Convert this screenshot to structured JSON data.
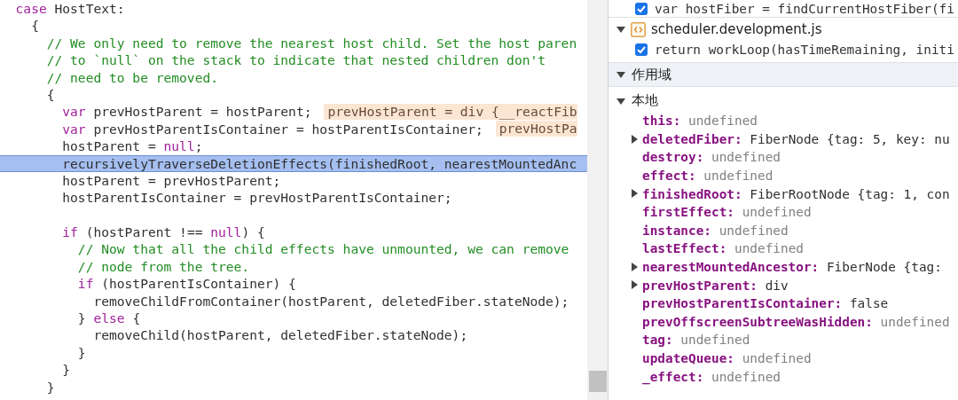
{
  "editor": {
    "lines": [
      {
        "kind": "code",
        "highlighted": false,
        "segments": [
          {
            "kind": "keyword",
            "text": "  case"
          },
          {
            "kind": "plain",
            "text": " HostText:"
          }
        ]
      },
      {
        "kind": "code",
        "highlighted": false,
        "segments": [
          {
            "kind": "plain",
            "text": "    {"
          }
        ]
      },
      {
        "kind": "code",
        "highlighted": false,
        "segments": [
          {
            "kind": "comment",
            "text": "      // We only need to remove the nearest host child. Set the host paren"
          }
        ]
      },
      {
        "kind": "code",
        "highlighted": false,
        "segments": [
          {
            "kind": "comment",
            "text": "      // to `null` on the stack to indicate that nested children don't"
          }
        ]
      },
      {
        "kind": "code",
        "highlighted": false,
        "segments": [
          {
            "kind": "comment",
            "text": "      // need to be removed."
          }
        ]
      },
      {
        "kind": "code",
        "highlighted": false,
        "segments": [
          {
            "kind": "plain",
            "text": "      {"
          }
        ]
      },
      {
        "kind": "code",
        "highlighted": false,
        "segments": [
          {
            "kind": "keyword",
            "text": "        var"
          },
          {
            "kind": "plain",
            "text": " prevHostParent = hostParent;"
          }
        ],
        "inline_value": "prevHostParent = div {__reactFib"
      },
      {
        "kind": "code",
        "highlighted": false,
        "segments": [
          {
            "kind": "keyword",
            "text": "        var"
          },
          {
            "kind": "plain",
            "text": " prevHostParentIsContainer = hostParentIsContainer;"
          }
        ],
        "inline_value": "prevHostPa"
      },
      {
        "kind": "code",
        "highlighted": false,
        "segments": [
          {
            "kind": "plain",
            "text": "        hostParent = "
          },
          {
            "kind": "keyword",
            "text": "null"
          },
          {
            "kind": "plain",
            "text": ";"
          }
        ]
      },
      {
        "kind": "code",
        "highlighted": true,
        "segments": [
          {
            "kind": "plain",
            "text": "        recursivelyTraverseDeletionEffects(finishedRoot, nearestMountedAnc"
          }
        ]
      },
      {
        "kind": "code",
        "highlighted": false,
        "segments": [
          {
            "kind": "plain",
            "text": "        hostParent = prevHostParent;"
          }
        ]
      },
      {
        "kind": "code",
        "highlighted": false,
        "segments": [
          {
            "kind": "plain",
            "text": "        hostParentIsContainer = prevHostParentIsContainer;"
          }
        ]
      },
      {
        "kind": "blank"
      },
      {
        "kind": "code",
        "highlighted": false,
        "segments": [
          {
            "kind": "keyword",
            "text": "        if"
          },
          {
            "kind": "plain",
            "text": " (hostParent !== "
          },
          {
            "kind": "keyword",
            "text": "null"
          },
          {
            "kind": "plain",
            "text": ") {"
          }
        ]
      },
      {
        "kind": "code",
        "highlighted": false,
        "segments": [
          {
            "kind": "comment",
            "text": "          // Now that all the child effects have unmounted, we can remove"
          }
        ]
      },
      {
        "kind": "code",
        "highlighted": false,
        "segments": [
          {
            "kind": "comment",
            "text": "          // node from the tree."
          }
        ]
      },
      {
        "kind": "code",
        "highlighted": false,
        "segments": [
          {
            "kind": "keyword",
            "text": "          if"
          },
          {
            "kind": "plain",
            "text": " (hostParentIsContainer) {"
          }
        ]
      },
      {
        "kind": "code",
        "highlighted": false,
        "segments": [
          {
            "kind": "plain",
            "text": "            removeChildFromContainer(hostParent, deletedFiber.stateNode);"
          }
        ]
      },
      {
        "kind": "code",
        "highlighted": false,
        "segments": [
          {
            "kind": "plain",
            "text": "          } "
          },
          {
            "kind": "keyword",
            "text": "else"
          },
          {
            "kind": "plain",
            "text": " {"
          }
        ]
      },
      {
        "kind": "code",
        "highlighted": false,
        "segments": [
          {
            "kind": "plain",
            "text": "            removeChild(hostParent, deletedFiber.stateNode);"
          }
        ]
      },
      {
        "kind": "code",
        "highlighted": false,
        "segments": [
          {
            "kind": "plain",
            "text": "          }"
          }
        ]
      },
      {
        "kind": "code",
        "highlighted": false,
        "segments": [
          {
            "kind": "plain",
            "text": "        }"
          }
        ]
      },
      {
        "kind": "code",
        "highlighted": false,
        "segments": [
          {
            "kind": "plain",
            "text": "      }"
          }
        ]
      }
    ]
  },
  "breakpoints": [
    {
      "kind": "breakpoint",
      "checked": true,
      "text": "var hostFiber = findCurrentHostFiber(fi"
    },
    {
      "kind": "file",
      "expanded": true,
      "text": "scheduler.development.js"
    },
    {
      "kind": "breakpoint",
      "checked": true,
      "text": "return workLoop(hasTimeRemaining, initi"
    }
  ],
  "scope": {
    "title": "作用域",
    "expanded": true,
    "groups": [
      {
        "title": "本地",
        "expanded": true,
        "variables": [
          {
            "name": "this:",
            "value": "undefined",
            "kind": "undefined",
            "expandable": false
          },
          {
            "name": "deletedFiber:",
            "value": "FiberNode {tag: 5, key: nu",
            "kind": "object",
            "expandable": true
          },
          {
            "name": "destroy:",
            "value": "undefined",
            "kind": "undefined",
            "expandable": false
          },
          {
            "name": "effect:",
            "value": "undefined",
            "kind": "undefined",
            "expandable": false
          },
          {
            "name": "finishedRoot:",
            "value": "FiberRootNode {tag: 1, con",
            "kind": "object",
            "expandable": true
          },
          {
            "name": "firstEffect:",
            "value": "undefined",
            "kind": "undefined",
            "expandable": false
          },
          {
            "name": "instance:",
            "value": "undefined",
            "kind": "undefined",
            "expandable": false
          },
          {
            "name": "lastEffect:",
            "value": "undefined",
            "kind": "undefined",
            "expandable": false
          },
          {
            "name": "nearestMountedAncestor:",
            "value": "FiberNode {tag:",
            "kind": "object",
            "expandable": true
          },
          {
            "name": "prevHostParent:",
            "value": "div",
            "kind": "object",
            "expandable": true
          },
          {
            "name": "prevHostParentIsContainer:",
            "value": "false",
            "kind": "object",
            "expandable": false
          },
          {
            "name": "prevOffscreenSubtreeWasHidden:",
            "value": "undefined",
            "kind": "undefined",
            "expandable": false
          },
          {
            "name": "tag:",
            "value": "undefined",
            "kind": "undefined",
            "expandable": false
          },
          {
            "name": "updateQueue:",
            "value": "undefined",
            "kind": "undefined",
            "expandable": false
          },
          {
            "name": "_effect:",
            "value": "undefined",
            "kind": "undefined",
            "expandable": false
          }
        ]
      }
    ]
  }
}
